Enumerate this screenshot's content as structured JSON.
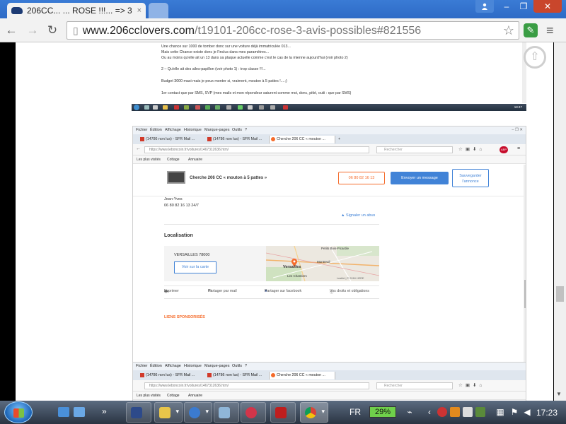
{
  "browser": {
    "tab": {
      "title": "206CC... ... ROSE !!!... => 3",
      "close": "×"
    },
    "url": {
      "host": "www.206cclovers.com",
      "path": "/t19101-206cc-rose-3-avis-possibles#821556"
    },
    "window": {
      "user_icon": "user-icon",
      "minimize": "–",
      "maximize": "❐",
      "close": "✕"
    },
    "icons": {
      "back": "back-arrow-icon",
      "forward": "forward-arrow-icon",
      "reload": "reload-icon",
      "star": "bookmark-star-icon",
      "extension": "evernote-clip-icon",
      "menu": "hamburger-menu-icon"
    }
  },
  "post_screenshot_1": {
    "lines": [
      "Une chance sur 1000 de tomber donc sur une voiture déjà immatriculée 013...",
      "Mais cette Chance existe donc je l'inclus dans mes paramètres...",
      "Ou au moins qu'elle ait un 13 dans sa plaque actuelle comme c'est le cas de la mienne aujourd'hui (voir photo 2)",
      "2 – Qu'elle ait des ailes-papillon (voir photo 1) : trop classe !!!...",
      "Budget 3000 maxi mais je peux monter si, vraiment, mouton à 5 pattes !....;)",
      "1er contact que par SMS, SVP (mes mails et mon répondeur saturent comme moi, donc, pitié, ouiii : que par SMS)"
    ],
    "clock": "18:47"
  },
  "post_screenshot_2": {
    "menu": [
      "Fichier",
      "Édition",
      "Affichage",
      "Historique",
      "Marque-pages",
      "Outils",
      "?"
    ],
    "tabs": [
      "(14786 non lus) - SFR Mail ...",
      "(14786 non lus) - SFR Mail ...",
      "Cherche 206 CC « mouton ..."
    ],
    "url": "https://www.leboncoin.fr/voitures/1467312636.htm/",
    "search_placeholder": "Rechercher",
    "abp": "ABP",
    "bookmarks": [
      "Les plus visités",
      "Cottage",
      "Annuaire"
    ],
    "ad_title": "Cherche 206 CC « mouton à 5 pattes »",
    "phone_button": "06 80 82 16 13",
    "send_button": "Envoyer un message",
    "save_button_line1": "Sauvegarder",
    "save_button_line2": "l'annonce",
    "seller_name": "Jean-Yves",
    "seller_phone": "06 80 82 16 13 24/7",
    "report": "Signaler un abus",
    "localisation_heading": "Localisation",
    "city": "VERSAILLES 78000",
    "map_button": "Voir sur la carte",
    "map_labels": {
      "petits_bois": "Petits Bois-Picardie",
      "montreuil": "Montreuil",
      "versailles": "Versailles",
      "chantiers": "Les Chantiers",
      "attrib": "Leaflet | © 2018 HERE"
    },
    "actions": [
      "Imprimer",
      "Partager par mail",
      "Partager sur facebook",
      "Vos droits et obligations"
    ],
    "sponsored": "LIENS SPONSORISÉS",
    "clock": "18:47"
  },
  "post_screenshot_3": {
    "menu": [
      "Fichier",
      "Édition",
      "Affichage",
      "Historique",
      "Marque-pages",
      "Outils",
      "?"
    ],
    "tabs": [
      "(14786 non lus) - SFR Mail ...",
      "(14786 non lus) - SFR Mail ...",
      "Cherche 206 CC « mouton ..."
    ],
    "url": "https://www.leboncoin.fr/voitures/1467312636.htm/",
    "search_placeholder": "Rechercher",
    "bookmarks": [
      "Les plus visités",
      "Cottage",
      "Annuaire"
    ]
  },
  "taskbar": {
    "language": "FR",
    "battery": "29%",
    "clock": "17:23",
    "chevron": "»"
  }
}
